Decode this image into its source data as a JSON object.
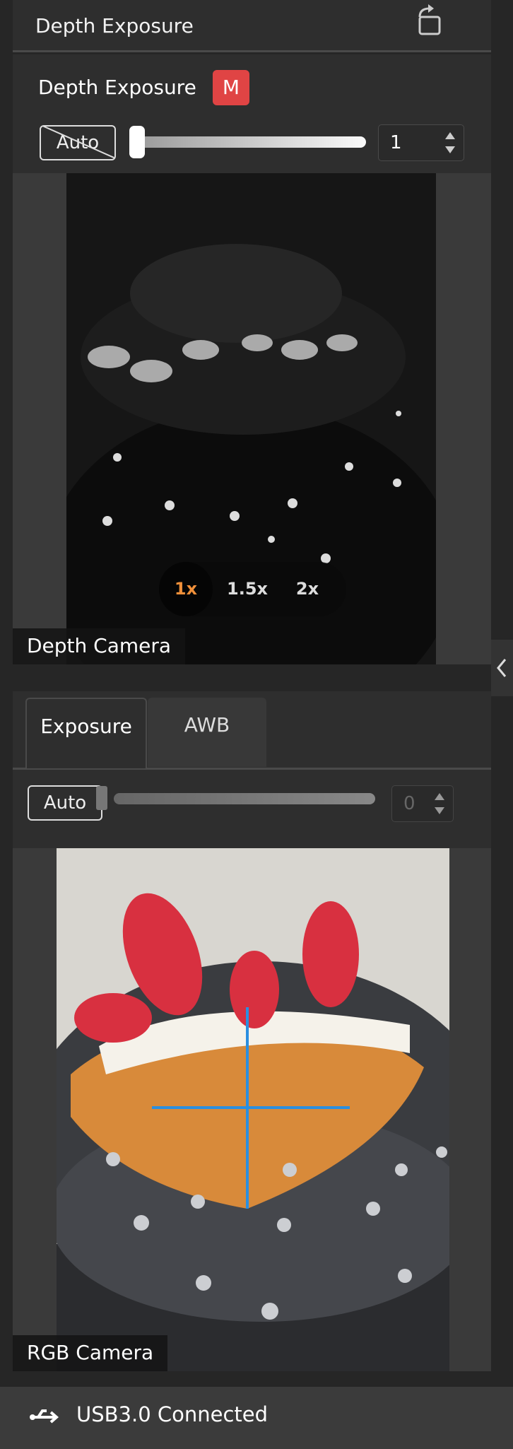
{
  "header": {
    "title": "Depth Exposure",
    "icon": "rotate-icon"
  },
  "depth_controls": {
    "label": "Depth Exposure",
    "mode_badge": "M",
    "badge_color": "#e04444",
    "auto_label": "Auto",
    "auto_enabled": false,
    "value": "1",
    "slider_fraction": 0
  },
  "depth_view": {
    "caption": "Depth Camera",
    "zoom_options": [
      "1x",
      "1.5x",
      "2x"
    ],
    "zoom_selected": "1x",
    "accent_color": "#f0903a"
  },
  "rgb_controls": {
    "tabs": [
      {
        "label": "Exposure",
        "active": true
      },
      {
        "label": "AWB",
        "active": false
      }
    ],
    "auto_label": "Auto",
    "auto_enabled": true,
    "value": "0",
    "slider_fraction": 0
  },
  "rgb_view": {
    "caption": "RGB Camera",
    "crosshair_color": "#2a8fe0"
  },
  "collapse_handle": {
    "icon": "chevron-left-icon"
  },
  "footer": {
    "icon": "usb-icon",
    "status": "USB3.0 Connected"
  }
}
